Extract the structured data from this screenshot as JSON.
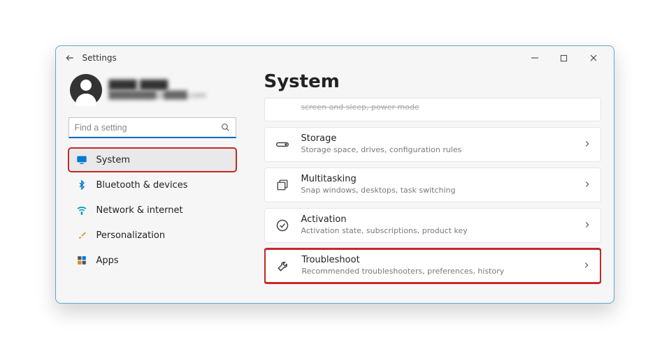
{
  "window": {
    "app_title": "Settings"
  },
  "profile": {
    "name": "████ ████",
    "email": "████████@████.com"
  },
  "search": {
    "placeholder": "Find a setting",
    "value": ""
  },
  "sidebar": {
    "items": [
      {
        "id": "system",
        "label": "System",
        "selected": true
      },
      {
        "id": "bluetooth",
        "label": "Bluetooth & devices"
      },
      {
        "id": "network",
        "label": "Network & internet"
      },
      {
        "id": "personalization",
        "label": "Personalization"
      },
      {
        "id": "apps",
        "label": "Apps"
      }
    ]
  },
  "main": {
    "title": "System",
    "truncated_card": {
      "subtitle_fragment": "screen and sleep, power mode"
    },
    "cards": [
      {
        "id": "storage",
        "title": "Storage",
        "subtitle": "Storage space, drives, configuration rules"
      },
      {
        "id": "multitasking",
        "title": "Multitasking",
        "subtitle": "Snap windows, desktops, task switching"
      },
      {
        "id": "activation",
        "title": "Activation",
        "subtitle": "Activation state, subscriptions, product key"
      },
      {
        "id": "troubleshoot",
        "title": "Troubleshoot",
        "subtitle": "Recommended troubleshooters, preferences, history",
        "highlight": true
      }
    ]
  }
}
